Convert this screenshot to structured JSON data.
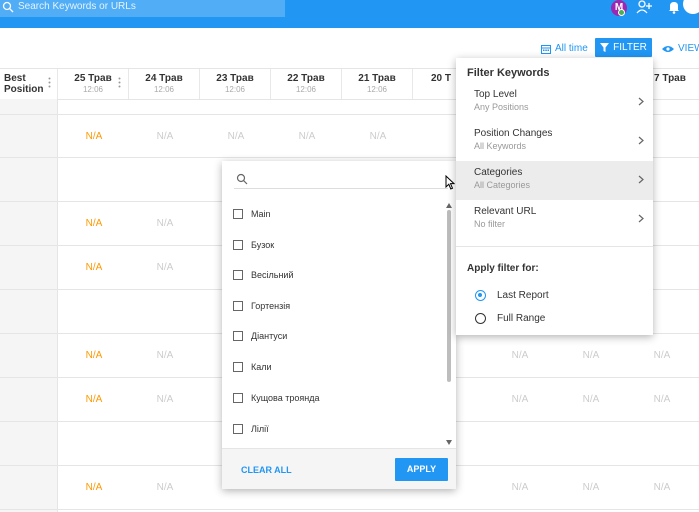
{
  "header": {
    "search_placeholder": "Search Keywords or URLs",
    "avatar_letter": "M"
  },
  "toolbar": {
    "all_time_label": "All time",
    "filter_label": "FILTER",
    "view_label": "VIEW"
  },
  "table": {
    "best_position_header": "Best\nPosition",
    "columns": [
      {
        "date": "25 Трав",
        "time": "12:06"
      },
      {
        "date": "24 Трав",
        "time": "12:06"
      },
      {
        "date": "23 Трав",
        "time": "12:06"
      },
      {
        "date": "22 Трав",
        "time": "12:06"
      },
      {
        "date": "21 Трав",
        "time": "12:06"
      },
      {
        "date": "20 Т",
        "time": ""
      },
      {
        "date": "7 Трав",
        "time": ""
      }
    ],
    "na_label": "N/A"
  },
  "category_dropdown": {
    "search_placeholder": "",
    "items": [
      "Main",
      "Бузок",
      "Весільний",
      "Гортензія",
      "Діантуси",
      "Кали",
      "Кущова троянда",
      "Лілії"
    ],
    "clear_all_label": "CLEAR ALL",
    "apply_label": "APPLY"
  },
  "filter_panel": {
    "title": "Filter Keywords",
    "rows": [
      {
        "label": "Top Level",
        "sub": "Any Positions"
      },
      {
        "label": "Position Changes",
        "sub": "All Keywords"
      },
      {
        "label": "Categories",
        "sub": "All Categories"
      },
      {
        "label": "Relevant URL",
        "sub": "No filter"
      }
    ],
    "apply_for_label": "Apply filter for:",
    "options": [
      "Last Report",
      "Full Range"
    ],
    "selected_option": "Last Report"
  },
  "colors": {
    "accent": "#2196f3",
    "na_orange": "#ff9800",
    "na_grey": "#cccccc"
  }
}
